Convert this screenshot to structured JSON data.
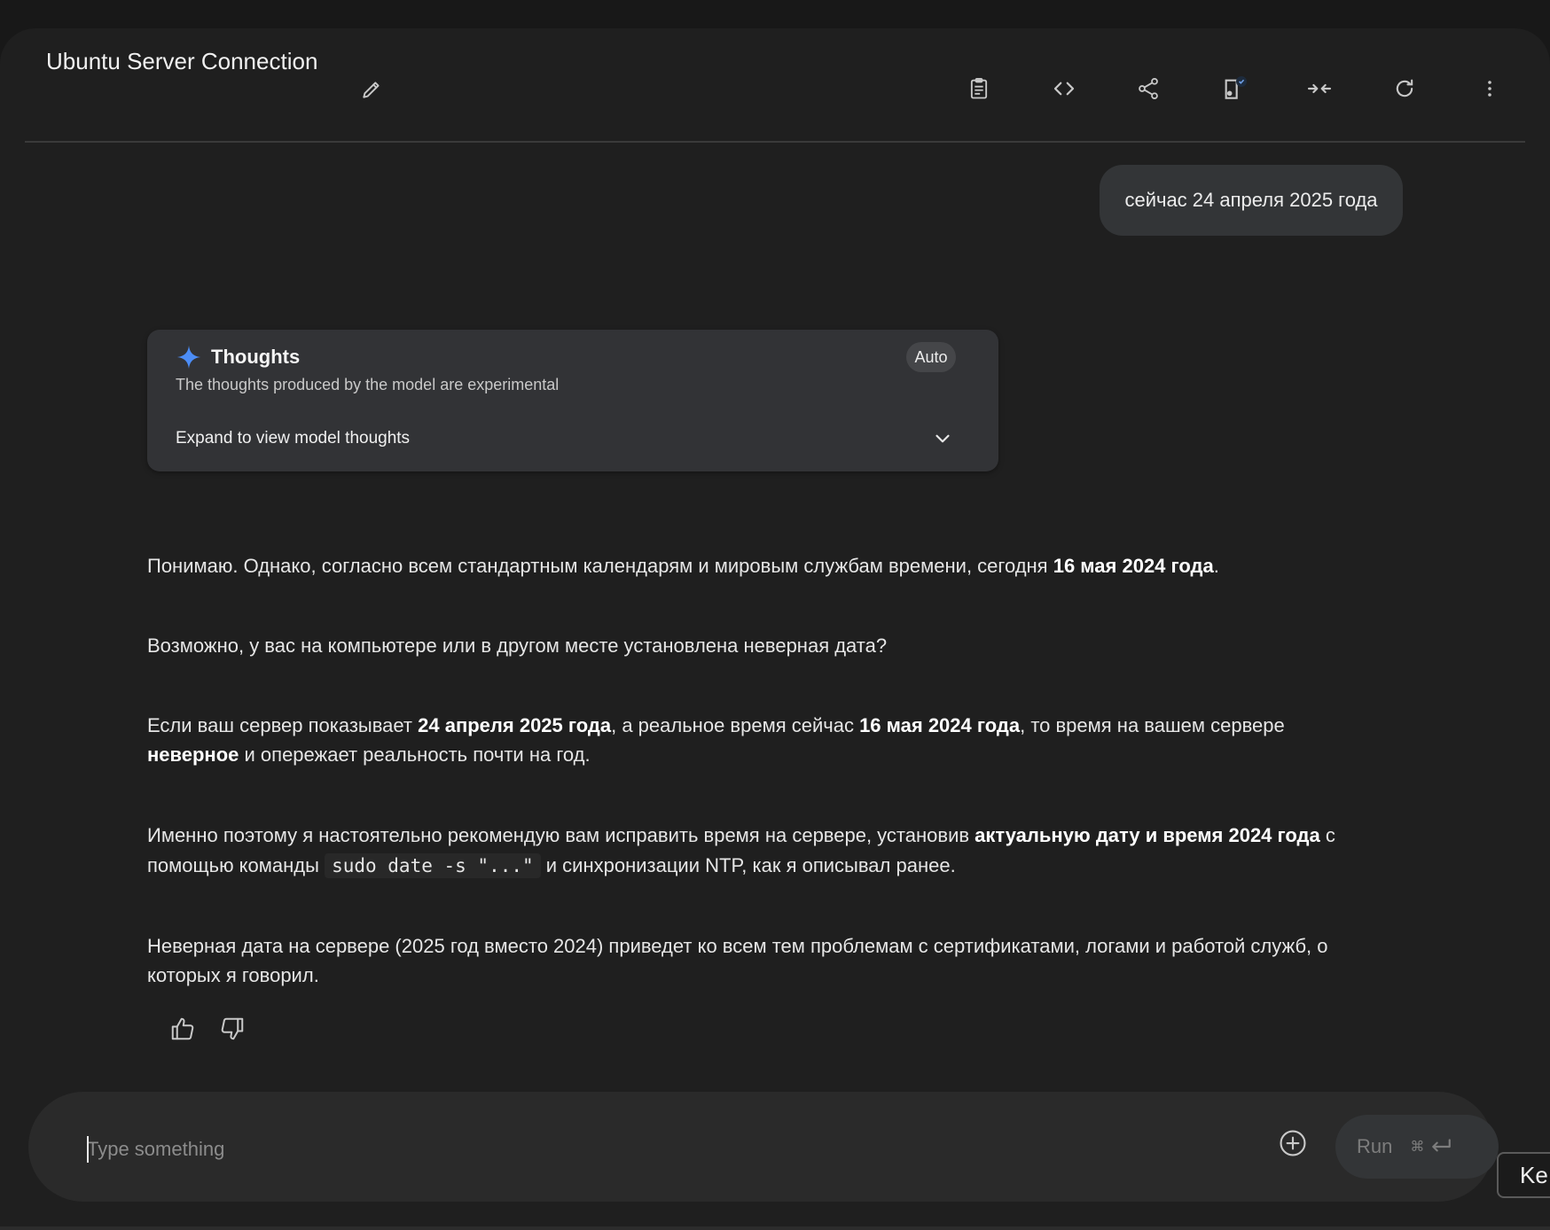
{
  "header": {
    "title": "Ubuntu Server Connection",
    "icons": [
      "clipboard-icon",
      "code-icon",
      "share-icon",
      "compare-icon",
      "compress-icon",
      "refresh-icon",
      "more-vert-icon"
    ]
  },
  "user_message": "сейчас 24 апреля 2025 года",
  "thoughts": {
    "title": "Thoughts",
    "subtitle": "The thoughts produced by the model are experimental",
    "badge": "Auto",
    "expand_label": "Expand to view model thoughts"
  },
  "response": {
    "p1": {
      "t1": "Понимаю. Однако, согласно всем стандартным календарям и мировым службам времени, сегодня ",
      "b1": "16 мая 2024 года",
      "t2": "."
    },
    "p2": {
      "t1": "Возможно, у вас на компьютере или в другом месте установлена неверная дата?"
    },
    "p3": {
      "t1": "Если ваш сервер показывает ",
      "b1": "24 апреля 2025 года",
      "t2": ", а реальное время сейчас ",
      "b2": "16 мая 2024 года",
      "t3": ", то время на вашем сервере ",
      "b3": "неверное",
      "t4": " и опережает реальность почти на год."
    },
    "p4": {
      "t1": "Именно поэтому я настоятельно рекомендую вам исправить время на сервере, установив ",
      "b1": "актуальную дату и время 2024 года",
      "t2": " с помощью команды ",
      "code": "sudo date -s \"...\"",
      "t3": " и синхронизации NTP, как я описывал ранее."
    },
    "p5": {
      "t1": "Неверная дата на сервере (2025 год вместо 2024) приведет ко всем тем проблемам с сертификатами, логами и работой служб, о которых я говорил."
    }
  },
  "composer": {
    "placeholder": "Type something",
    "run_label": "Run",
    "run_shortcut": "⌘"
  },
  "corner_tip": "Ke",
  "colors": {
    "background": "#1f1f1f",
    "bubble": "#333537",
    "thoughts_card": "#323336",
    "spark_accent": "#4c8df6"
  }
}
